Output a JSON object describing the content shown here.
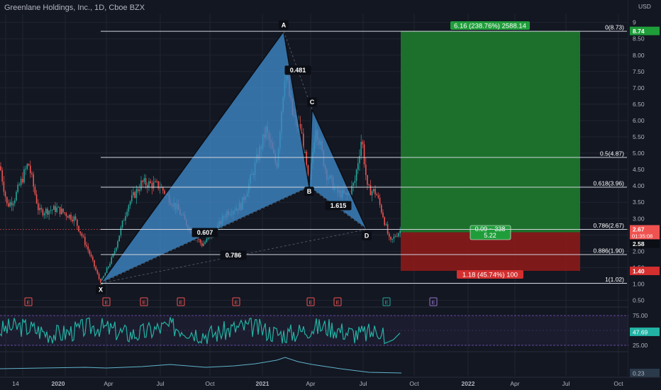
{
  "header": {
    "title": "Greenlane Holdings, Inc., 1D, Cboe BZX",
    "currency": "USD"
  },
  "colors": {
    "background": "#131722",
    "grid": "#1f2430",
    "pattern_fill": "#3f87c6",
    "pattern_stroke": "#0b0e14",
    "long_profit": "#1e7a2c",
    "long_loss": "#8b1a1a",
    "candle_up": "#26a69a",
    "candle_down": "#ef5350",
    "rsi_line": "#22b3a4",
    "rsi_band": "#7e57c2",
    "lower_line": "#5fb3c9",
    "fib_line": "#d1d4dc"
  },
  "chart_data": {
    "type": "candlestick",
    "price_axis": {
      "ticks": [
        "0.50",
        "1.00",
        "1.50",
        "2.00",
        "2.50",
        "3.00",
        "3.50",
        "4.00",
        "4.50",
        "5.00",
        "5.50",
        "6.00",
        "6.50",
        "7.00",
        "7.50",
        "8.00",
        "8.50",
        "9"
      ],
      "range": [
        0.4,
        9.1
      ]
    },
    "time_axis": {
      "labels": [
        "14",
        "2020",
        "Apr",
        "Jul",
        "Oct",
        "2021",
        "Apr",
        "Jul",
        "Oct",
        "2022",
        "Apr",
        "Jul",
        "Oct"
      ]
    },
    "harmonic_pattern": {
      "points": [
        {
          "label": "X",
          "date_index": 0,
          "price": 1.02
        },
        {
          "label": "A",
          "date_index": 1,
          "price": 8.73
        },
        {
          "label": "B",
          "date_index": 2,
          "price": 3.96
        },
        {
          "label": "C",
          "date_index": 3,
          "price": 6.35
        },
        {
          "label": "D",
          "date_index": 4,
          "price": 2.67
        }
      ],
      "ratios": [
        "0.607",
        "0.786",
        "0.481",
        "1.615"
      ]
    },
    "fib_levels": [
      {
        "label": "0(8.73)",
        "price": 8.73
      },
      {
        "label": "0.5(4.87)",
        "price": 4.87
      },
      {
        "label": "0.618(3.96)",
        "price": 3.96
      },
      {
        "label": "0.786(2.67)",
        "price": 2.67
      },
      {
        "label": "0.886(1.90)",
        "price": 1.9
      },
      {
        "label": "1(1.02)",
        "price": 1.02
      }
    ],
    "position": {
      "entry": 2.58,
      "target": 8.74,
      "stop": 1.4,
      "target_label": "6.16 (238.76%) 2588.14",
      "stop_label": "1.18 (45.74%) 100",
      "entry_label_1": "0.09 ~ 338",
      "entry_label_2": "5.22"
    },
    "price_tags": {
      "last": "2.67",
      "last_timer": "01:35:08",
      "entry": "2.58",
      "target": "8.74",
      "stop": "1.40"
    },
    "earnings_markers": 9,
    "rsi": {
      "value": "47.69",
      "ticks": [
        "75.00",
        "25.00"
      ],
      "upper": 75,
      "lower": 25
    },
    "lower_indicator": {
      "value": "0.23"
    }
  }
}
